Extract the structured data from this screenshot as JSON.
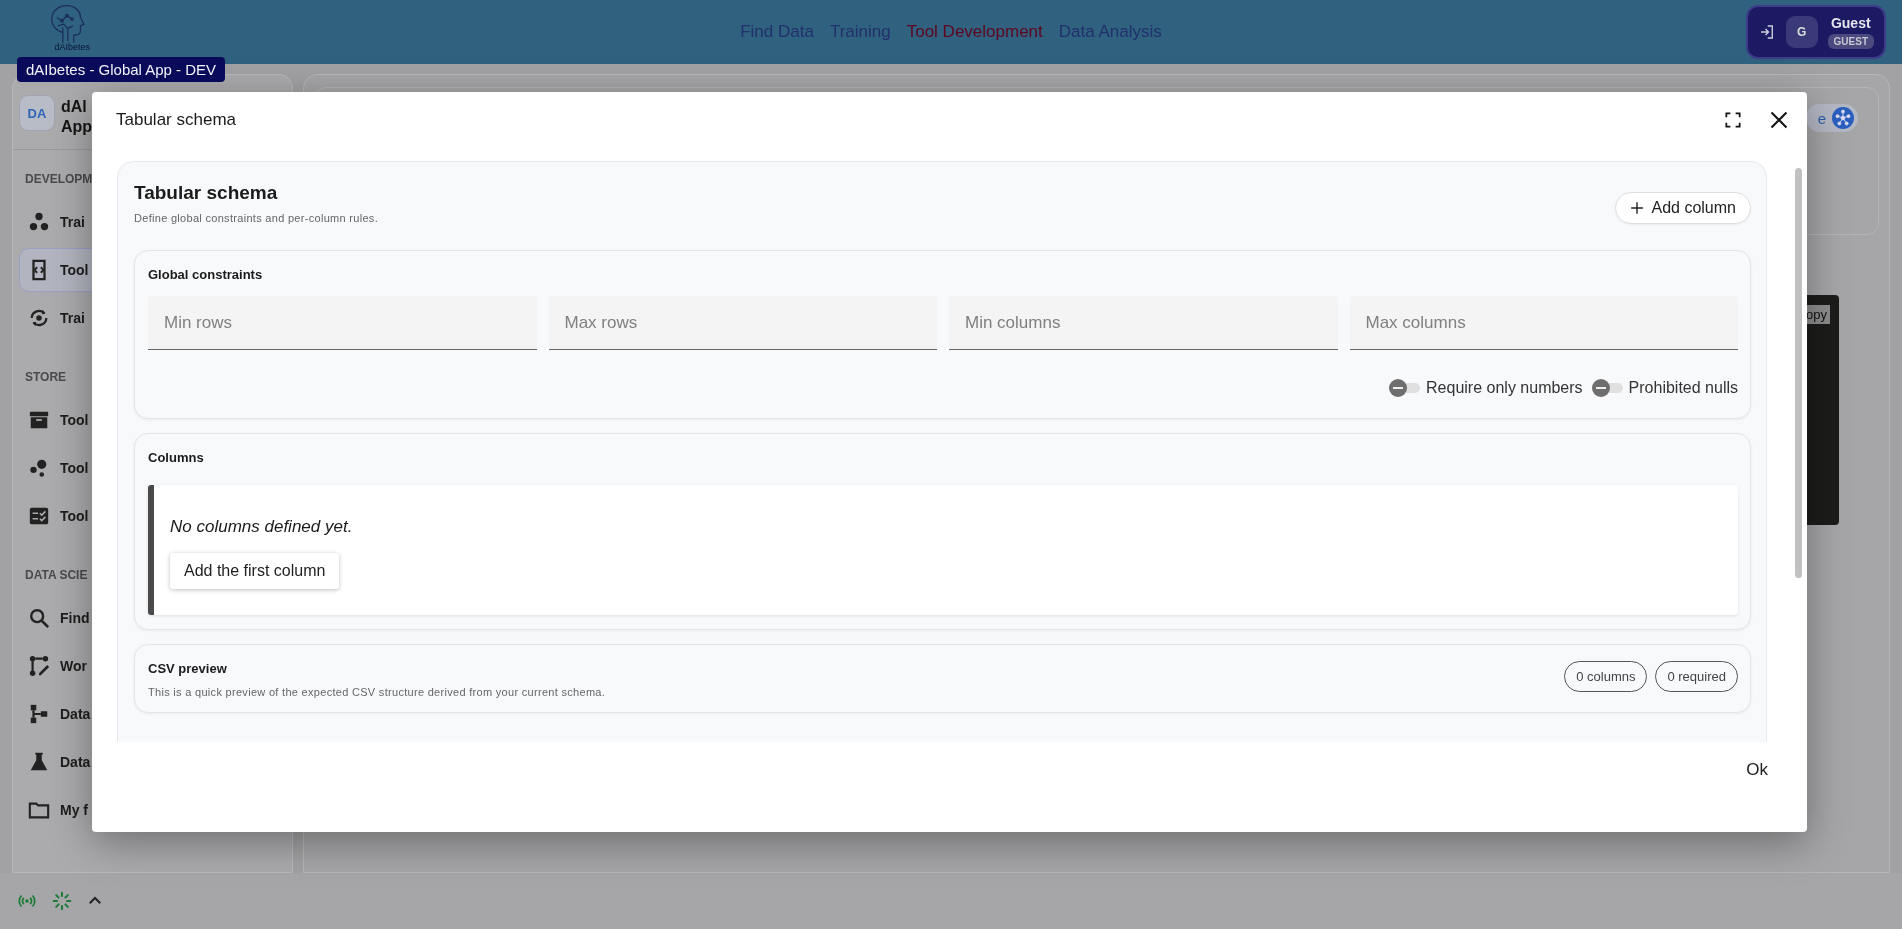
{
  "header": {
    "logo_caption": "dAIbetes",
    "nav": [
      {
        "label": "Find Data",
        "selected": false
      },
      {
        "label": "Training",
        "selected": false
      },
      {
        "label": "Tool Development",
        "selected": true
      },
      {
        "label": "Data Analysis",
        "selected": false
      }
    ],
    "user": {
      "avatar": "G",
      "name": "Guest",
      "role": "GUEST"
    }
  },
  "tooltip": "dAIbetes - Global App - DEV",
  "sidebar": {
    "avatar": "DA",
    "title_lines": [
      "dAl",
      "App"
    ],
    "sections": [
      {
        "title": "DEVELOPM",
        "items": [
          {
            "label": "Trai",
            "kind": "dots",
            "selected": false
          },
          {
            "label": "Tool",
            "kind": "code",
            "selected": true
          },
          {
            "label": "Trai",
            "kind": "cycle",
            "selected": false
          }
        ]
      },
      {
        "title": "STORE",
        "items": [
          {
            "label": "Tool",
            "kind": "archive",
            "selected": false
          },
          {
            "label": "Tool",
            "kind": "bubbles",
            "selected": false
          },
          {
            "label": "Tool",
            "kind": "checklist",
            "selected": false
          }
        ]
      },
      {
        "title": "DATA SCIE",
        "items": [
          {
            "label": "Find",
            "kind": "search",
            "selected": false
          },
          {
            "label": "Wor",
            "kind": "workflow",
            "selected": false
          },
          {
            "label": "Data",
            "kind": "tree",
            "selected": false
          },
          {
            "label": "Data",
            "kind": "flask",
            "selected": false
          },
          {
            "label": "My f",
            "kind": "folder",
            "selected": false
          }
        ]
      }
    ]
  },
  "main": {
    "chip_text": "e",
    "code_button": "opy"
  },
  "dialog": {
    "title": "Tabular schema",
    "schema": {
      "title": "Tabular schema",
      "subtitle": "Define global constraints and per-column rules.",
      "add_button": "Add column",
      "global": {
        "title": "Global constraints",
        "fields": [
          {
            "placeholder": "Min rows"
          },
          {
            "placeholder": "Max rows"
          },
          {
            "placeholder": "Min columns"
          },
          {
            "placeholder": "Max columns"
          }
        ],
        "toggles": [
          {
            "label": "Require only numbers",
            "on": false
          },
          {
            "label": "Prohibited nulls",
            "on": false
          }
        ]
      },
      "columns": {
        "title": "Columns",
        "empty_text": "No columns defined yet.",
        "button": "Add the first column"
      },
      "csv_preview": {
        "title": "CSV preview",
        "description": "This is a quick preview of the expected CSV structure derived from your current schema.",
        "badges": [
          "0 columns",
          "0 required"
        ]
      }
    },
    "ok_button": "Ok"
  }
}
